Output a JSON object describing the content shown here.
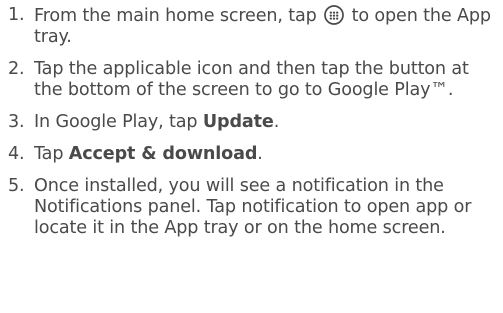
{
  "steps": [
    {
      "number": "1.",
      "text_before": "From the main home screen, tap ",
      "icon": "apps-grid-icon",
      "text_after": " to open the App tray."
    },
    {
      "number": "2.",
      "text": "Tap the applicable icon and then tap the button at the bottom of the screen to go to Google Play™."
    },
    {
      "number": "3.",
      "text_before": "In Google Play, tap ",
      "bold": "Update",
      "text_after": "."
    },
    {
      "number": "4.",
      "text_before": "Tap ",
      "bold": "Accept & download",
      "text_after": "."
    },
    {
      "number": "5.",
      "text": "Once installed, you will see a notification in the Notifications panel. Tap notification to open app or locate it in the App tray or on the home screen."
    }
  ]
}
